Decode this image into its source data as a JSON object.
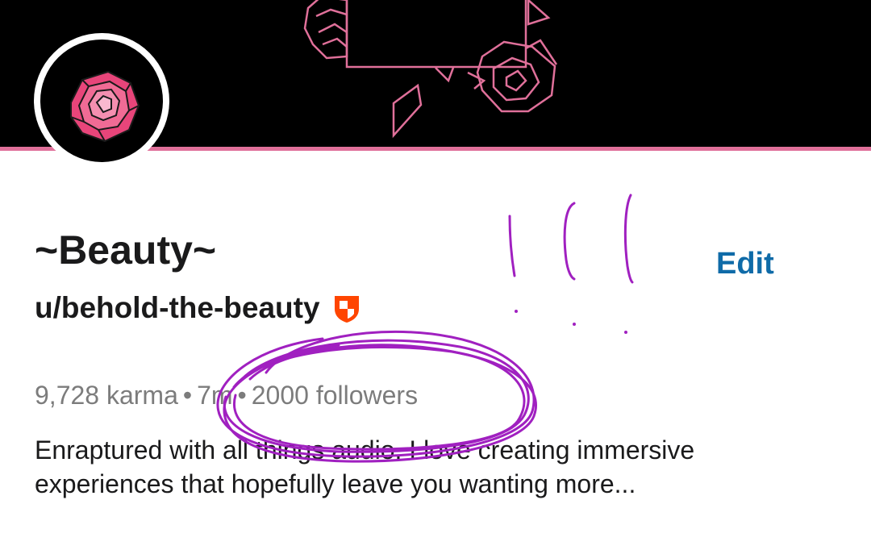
{
  "profile": {
    "display_name": "~Beauty~",
    "username": "u/behold-the-beauty",
    "edit_label": "Edit",
    "karma": "9,728 karma",
    "age": "7m",
    "followers": "2000 followers",
    "separator": "•",
    "bio": "Enraptured with all things audio. I love creating immersive experiences that hopefully leave you wanting more..."
  },
  "icons": {
    "avatar": "rose-icon",
    "badge": "moderator-shield-icon"
  },
  "colors": {
    "banner": "#000000",
    "banner_accent": "#e0709a",
    "link": "#0f6ba8",
    "muted_text": "#7c7c7c",
    "badge": "#ff4500",
    "scribble": "#a020c0"
  }
}
